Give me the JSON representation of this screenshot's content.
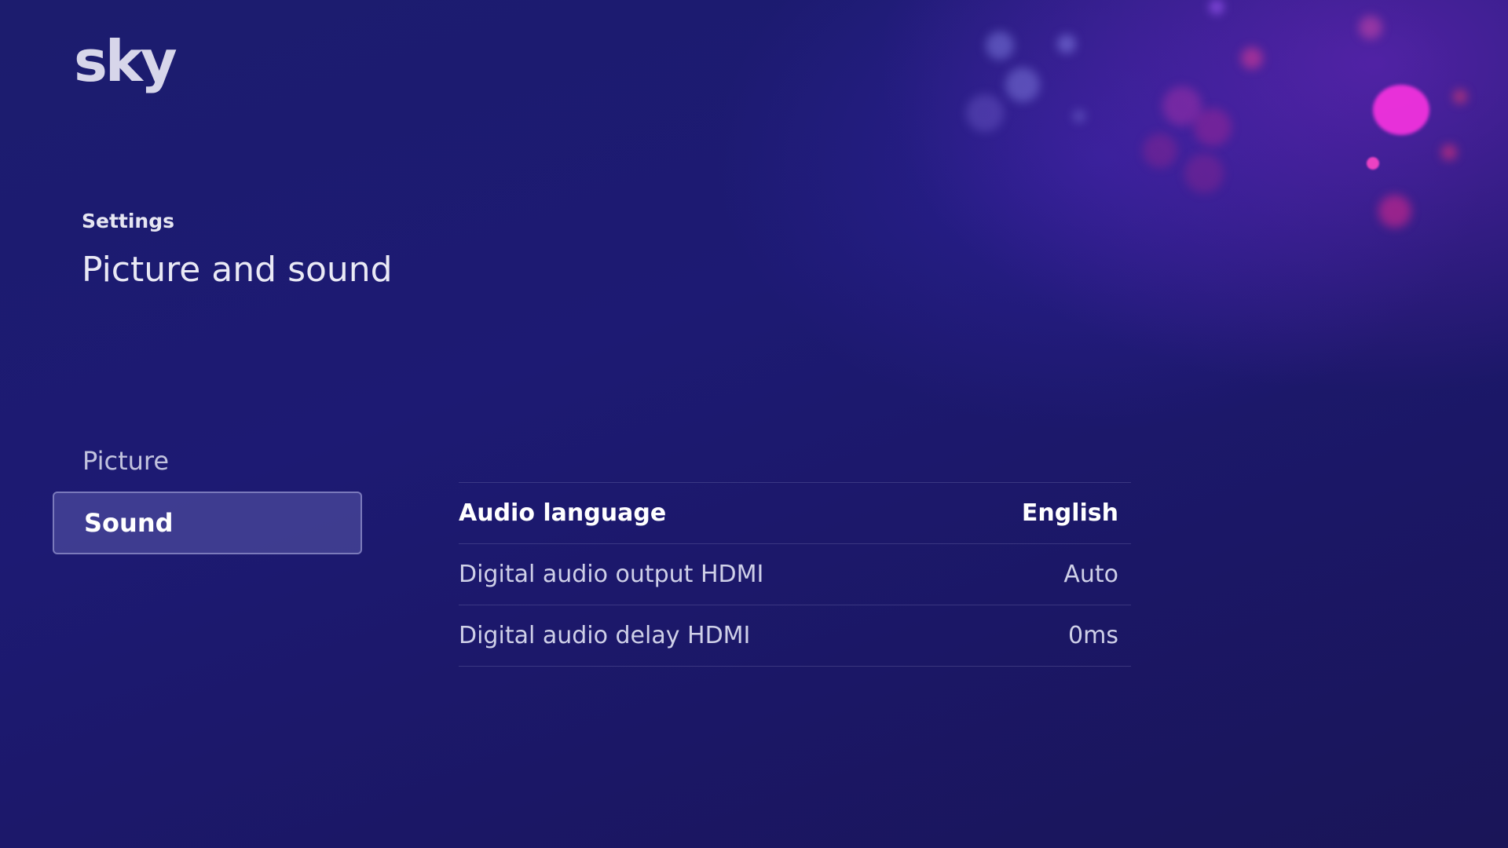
{
  "brand": {
    "logo_text": "sky"
  },
  "header": {
    "breadcrumb": "Settings",
    "title": "Picture and sound"
  },
  "side_menu": {
    "items": [
      {
        "label": "Picture",
        "selected": false
      },
      {
        "label": "Sound",
        "selected": true
      }
    ]
  },
  "settings": {
    "rows": [
      {
        "label": "Audio language",
        "value": "English",
        "focused": true
      },
      {
        "label": "Digital audio output HDMI",
        "value": "Auto",
        "focused": false
      },
      {
        "label": "Digital audio delay HDMI",
        "value": "0ms",
        "focused": false
      }
    ]
  },
  "colors": {
    "background": "#1d1a73",
    "accent_pink": "#e23bd6",
    "text_primary": "#ffffff",
    "text_secondary": "#c2c3de"
  }
}
